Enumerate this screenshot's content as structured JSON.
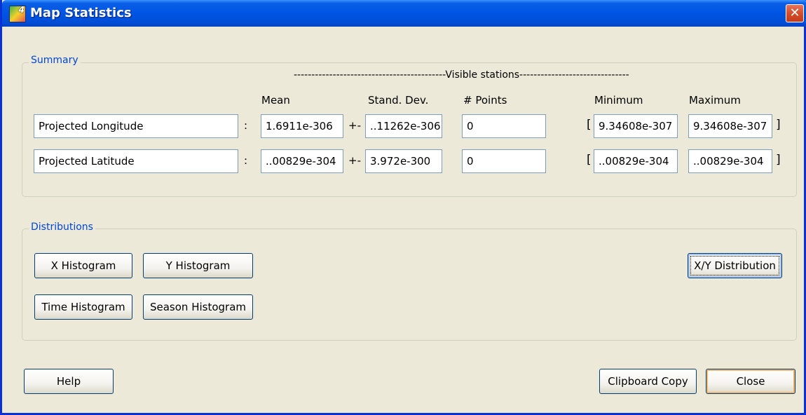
{
  "window": {
    "title": "Map Statistics",
    "icon_glyph": "4",
    "close_glyph": "✕"
  },
  "summary": {
    "legend": "Summary",
    "visible_header": "-------------------------------------------Visible stations-------------------------------",
    "columns": {
      "mean": "Mean",
      "std": "Stand. Dev.",
      "points": "# Points",
      "min": "Minimum",
      "max": "Maximum"
    },
    "colon": ":",
    "plusminus": "+-",
    "open_bracket": "[",
    "close_bracket": "]",
    "rows": [
      {
        "name": "Projected Longitude",
        "mean": "1.6911e-306",
        "std": "..11262e-306",
        "points": "0",
        "min": "9.34608e-307",
        "max": "9.34608e-307"
      },
      {
        "name": "Projected Latitude",
        "mean": "..00829e-304",
        "std": "3.972e-300",
        "points": "0",
        "min": "..00829e-304",
        "max": "..00829e-304"
      }
    ]
  },
  "distributions": {
    "legend": "Distributions",
    "x_histogram": "X Histogram",
    "y_histogram": "Y Histogram",
    "time_histogram": "Time Histogram",
    "season_histogram": "Season Histogram",
    "xy_distribution": "X/Y Distribution"
  },
  "footer": {
    "help": "Help",
    "clipboard_copy": "Clipboard Copy",
    "close": "Close"
  }
}
